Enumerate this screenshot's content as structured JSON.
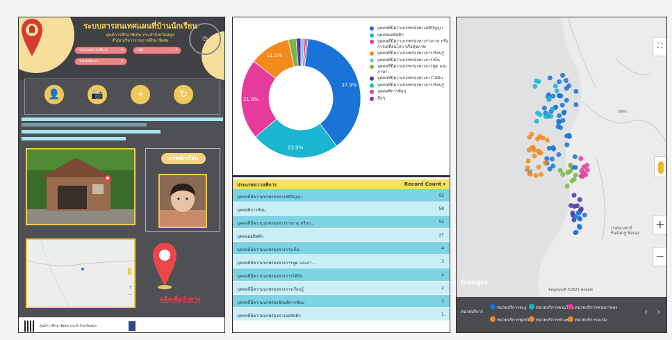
{
  "left_panel": {
    "title": "ระบบสารสนเทศแผนที่บ้านนักเรียน",
    "subtitle_1": "ศูนย์การศึกษาพิเศษ ประจำจังหวัดสตูล",
    "subtitle_2": "สำนักบริหารงานการศึกษาพิเศษ",
    "filters": [
      {
        "label": "ประเภทความพิการ"
      },
      {
        "label": "เพศ"
      },
      {
        "label": "หน่วยบริการ"
      }
    ],
    "action_icons": [
      "add-user-icon",
      "camera-icon",
      "location-search-icon",
      "refresh-icon"
    ],
    "student_photo_label": "ภาพนักเรียน",
    "navigate_link": "คลิกเพื่อนำทาง",
    "footer_text": "ศูนย์การศึกษาพิเศษ ประจำจังหวัดสตูล"
  },
  "colors": {
    "dark_panel": "#4e5054",
    "accent_yellow": "#f0c85a",
    "pin_red": "#e9474a",
    "table_header": "#f6df6d",
    "row_dark": "#7dd3e4",
    "row_light": "#c9eef5"
  },
  "chart_data": {
    "type": "pie",
    "donut": true,
    "series": [
      {
        "name": "บุคคลที่มีความบกพร่องทางสติปัญญา",
        "value": 37.9,
        "color": "#1a73d6"
      },
      {
        "name": "บุคคลออทิสติก",
        "value": 23.9,
        "color": "#1ab5d0"
      },
      {
        "name": "บุคคลที่มีความบกพร่องทางร่างกาย หรือการเคลื่อนไหว หรือสุขภาพ",
        "value": 21.8,
        "color": "#e63a9c"
      },
      {
        "name": "บุคคลที่มีความบกพร่องทางการเรียนรู้",
        "value": 11.1,
        "color": "#f28a1c"
      },
      {
        "name": "บุคคลที่มีความบกพร่องทางการพูด และภาษา",
        "value": 2.1,
        "color": "#7ab648"
      },
      {
        "name": "บุคคลที่มีความบกพร่องทางการได้ยิน",
        "value": 1.3,
        "color": "#4b3aa6"
      },
      {
        "name": "บุคคลที่มีความบกพร่องทางการเห็น",
        "value": 0.9,
        "color": "#7fc1e8"
      },
      {
        "name": "บุคคลพิการซ้อน",
        "value": 0.6,
        "color": "#d94b7c"
      },
      {
        "name": "อื่นๆ",
        "value": 0.4,
        "color": "#9b2fb5"
      }
    ],
    "labels_shown": [
      "37.9%",
      "23.9%",
      "21.8%",
      "11.1%"
    ]
  },
  "legend": [
    {
      "label": "บุคคลที่มีความบกพร่องทางสติปัญญา",
      "color": "#1a73d6"
    },
    {
      "label": "บุคคลออทิสติก",
      "color": "#1ab5d0"
    },
    {
      "label": "บุคคลที่มีความบกพร่องทางร่างกาย หรือการเคลื่อนไหว หรือสุขภาพ",
      "color": "#e63a9c"
    },
    {
      "label": "บุคคลที่มีความบกพร่องทางการเรียนรู้",
      "color": "#f28a1c"
    },
    {
      "label": "บุคคลที่มีความบกพร่องทางการเห็น",
      "color": "#7fc1e8"
    },
    {
      "label": "บุคคลที่มีความบกพร่องทางการพูด และภาษา",
      "color": "#7ab648"
    },
    {
      "label": "บุคคลที่มีความบกพร่องทางการได้ยิน",
      "color": "#4b3aa6"
    },
    {
      "label": "บุคคลที่มีความบกพร่องทางการเรียนรู้",
      "color": "#1ab5d0"
    },
    {
      "label": "บุคคลพิการซ้อน",
      "color": "#d94b7c"
    },
    {
      "label": "อื่นๆ",
      "color": "#9b2fb5"
    }
  ],
  "table": {
    "col1": "ประเภทความพิการ",
    "col2": "Record Count",
    "rows": [
      {
        "type": "บุคคลที่มีความบกพร่องทางสติปัญญา",
        "count": "92"
      },
      {
        "type": "บุคคลพิการซ้อน",
        "count": "58"
      },
      {
        "type": "บุคคลที่มีความบกพร่องทางร่างกาย หรือก...",
        "count": "52"
      },
      {
        "type": "บุคคลออทิสติก",
        "count": "27"
      },
      {
        "type": "บุคคลที่มีความบกพร่องทางการเห็น",
        "count": "4"
      },
      {
        "type": "บุคคลที่มีความบกพร่องทางการพูด และภา...",
        "count": "3"
      },
      {
        "type": "บุคคลที่มีความบกพร่องทางการได้ยิน",
        "count": "2"
      },
      {
        "type": "บุคคลที่มีความบกพร่องทางการเรียนรู้",
        "count": "2"
      },
      {
        "type": "บุคคลที่มีความบกพร่องซ้อนพิการซ้อน",
        "count": "1"
      },
      {
        "type": "บุคคลที่มีความบกพร่องทางออทิสติก",
        "count": "1"
      }
    ]
  },
  "map": {
    "places": [
      "สตูล",
      "Padang Besar",
      "เทพา",
      "ปาดังเบซาร์"
    ],
    "google_label": "Google",
    "attribution": "ข้อมูลแผนที่ ©2021 Google",
    "zoom_in": "+",
    "zoom_out": "−",
    "legend_title": "หน่วยบริการ",
    "legend": [
      {
        "label": "หน่วยบริการละงู",
        "color": "#1a73d6"
      },
      {
        "label": "หน่วยบริการควนโดน",
        "color": "#1ab5d0"
      },
      {
        "label": "หน่วยบริการควนกาหลง",
        "color": "#e63a9c"
      },
      {
        "label": "หน่วยบริการทุ่งหว้า",
        "color": "#f28a1c"
      },
      {
        "label": "หน่วยบริการท่าแพ",
        "color": "#f28a1c"
      },
      {
        "label": "หน่วยบริการมะนัง",
        "color": "#f28a1c"
      }
    ]
  }
}
